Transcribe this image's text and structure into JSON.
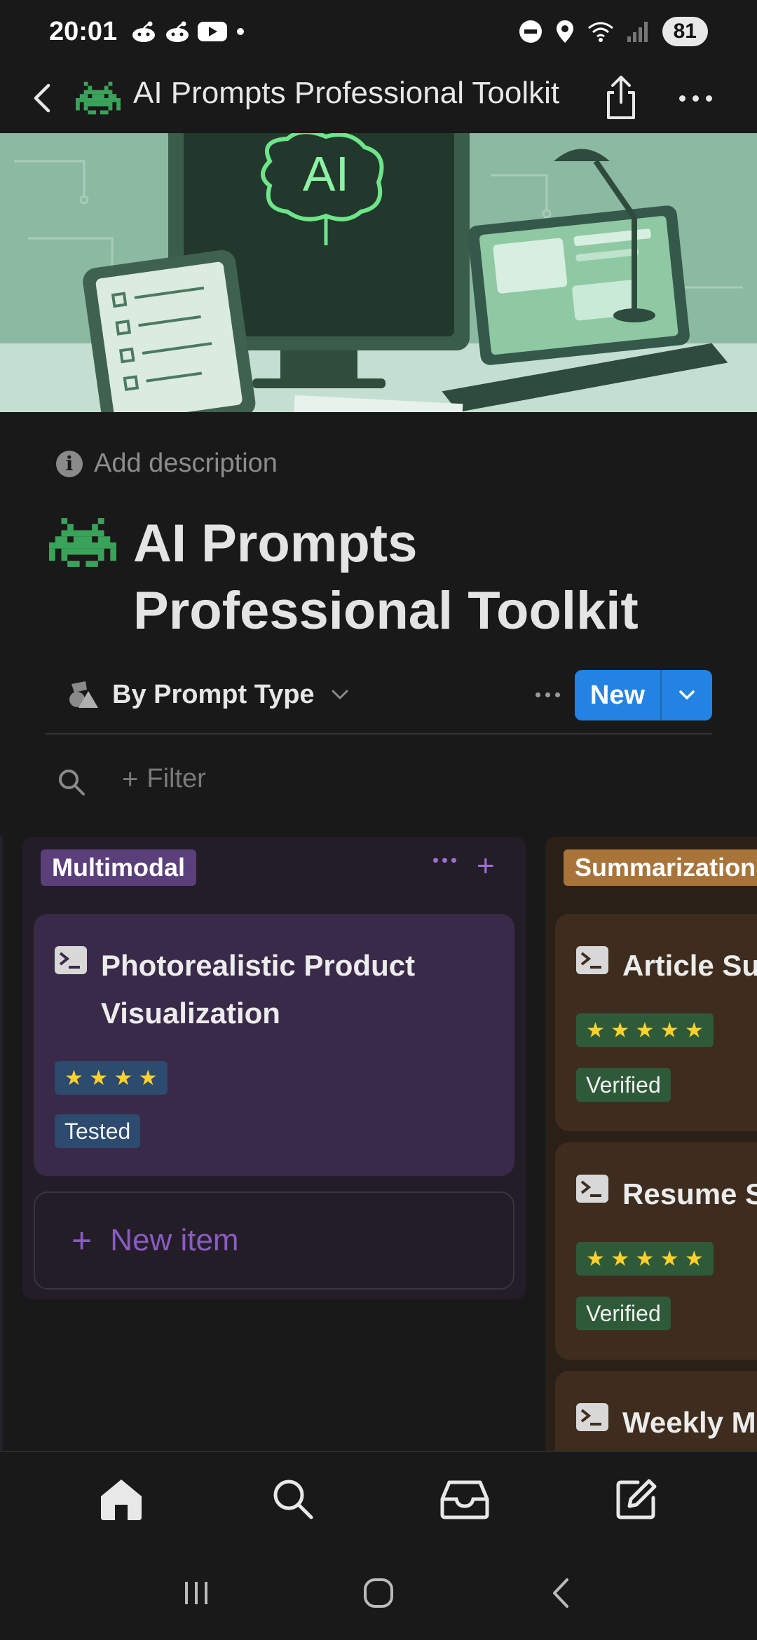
{
  "status_bar": {
    "time": "20:01",
    "battery": "81",
    "icons": [
      "reddit-icon",
      "reddit-icon",
      "youtube-icon",
      "dot-icon",
      "dnd-icon",
      "location-icon",
      "wifi-icon",
      "signal-icon"
    ]
  },
  "top_nav": {
    "title": "AI Prompts Professional Toolkit",
    "page_icon": "space-invader-icon"
  },
  "page": {
    "add_description": "Add description",
    "title": "AI Prompts Professional Toolkit",
    "icon": "space-invader-icon"
  },
  "view_bar": {
    "view_label": "By Prompt Type",
    "new_label": "New"
  },
  "filter": {
    "label": "Filter",
    "plus": "+"
  },
  "board": {
    "groups": [
      {
        "name": "Multimodal",
        "color": "#5a3f7a",
        "plus": "+",
        "cards": [
          {
            "title_line1": "Photorealistic Product",
            "title_line2": "Visualization",
            "stars": "★ ★ ★ ★",
            "rating": 4,
            "status": "Tested"
          }
        ],
        "new_item_label": "New item",
        "new_item_plus": "+"
      },
      {
        "name": "Summarization",
        "color": "#a8743a",
        "cards": [
          {
            "title": "Article Su",
            "stars": "★ ★ ★ ★ ★",
            "rating": 5,
            "status": "Verified"
          },
          {
            "title": "Resume S",
            "stars": "★ ★ ★ ★ ★",
            "rating": 5,
            "status": "Verified"
          },
          {
            "title": "Weekly M"
          }
        ]
      }
    ]
  },
  "tab_bar": {
    "tabs": [
      "home-icon",
      "search-icon",
      "inbox-icon",
      "compose-icon"
    ]
  },
  "system_nav": {
    "buttons": [
      "recents-icon",
      "home-circle-icon",
      "back-icon"
    ]
  },
  "colors": {
    "background": "#191919",
    "accent_blue": "#2383e2",
    "multimodal_purple": "#5a3f7a",
    "summarization_orange": "#a8743a",
    "star_yellow": "#ffd12e"
  }
}
